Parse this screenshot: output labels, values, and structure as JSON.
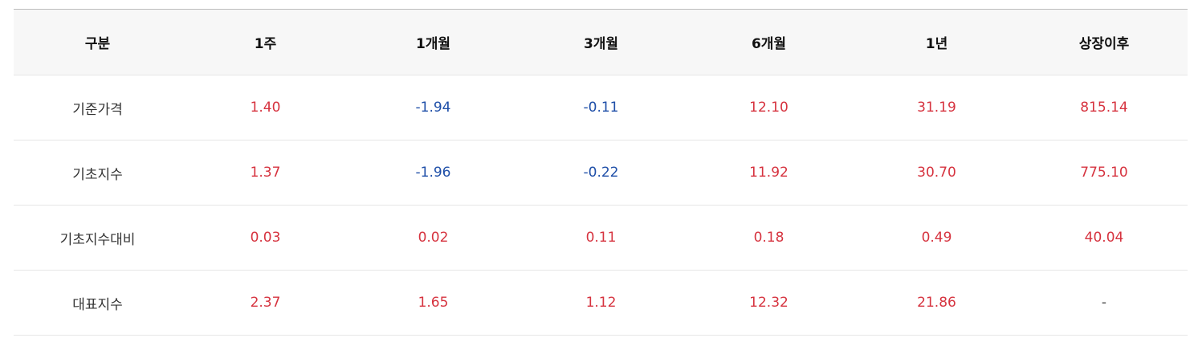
{
  "table": {
    "headers": [
      "구분",
      "1주",
      "1개월",
      "3개월",
      "6개월",
      "1년",
      "상장이후"
    ],
    "rows": [
      {
        "label": "기준가격",
        "values": [
          "1.40",
          "-1.94",
          "-0.11",
          "12.10",
          "31.19",
          "815.14"
        ]
      },
      {
        "label": "기초지수",
        "values": [
          "1.37",
          "-1.96",
          "-0.22",
          "11.92",
          "30.70",
          "775.10"
        ]
      },
      {
        "label": "기초지수대비",
        "values": [
          "0.03",
          "0.02",
          "0.11",
          "0.18",
          "0.49",
          "40.04"
        ]
      },
      {
        "label": "대표지수",
        "values": [
          "2.37",
          "1.65",
          "1.12",
          "12.32",
          "21.86",
          "-"
        ]
      }
    ]
  },
  "colors": {
    "positive": "#d6333f",
    "negative": "#1f4fa8",
    "header_bg": "#f7f7f7"
  }
}
